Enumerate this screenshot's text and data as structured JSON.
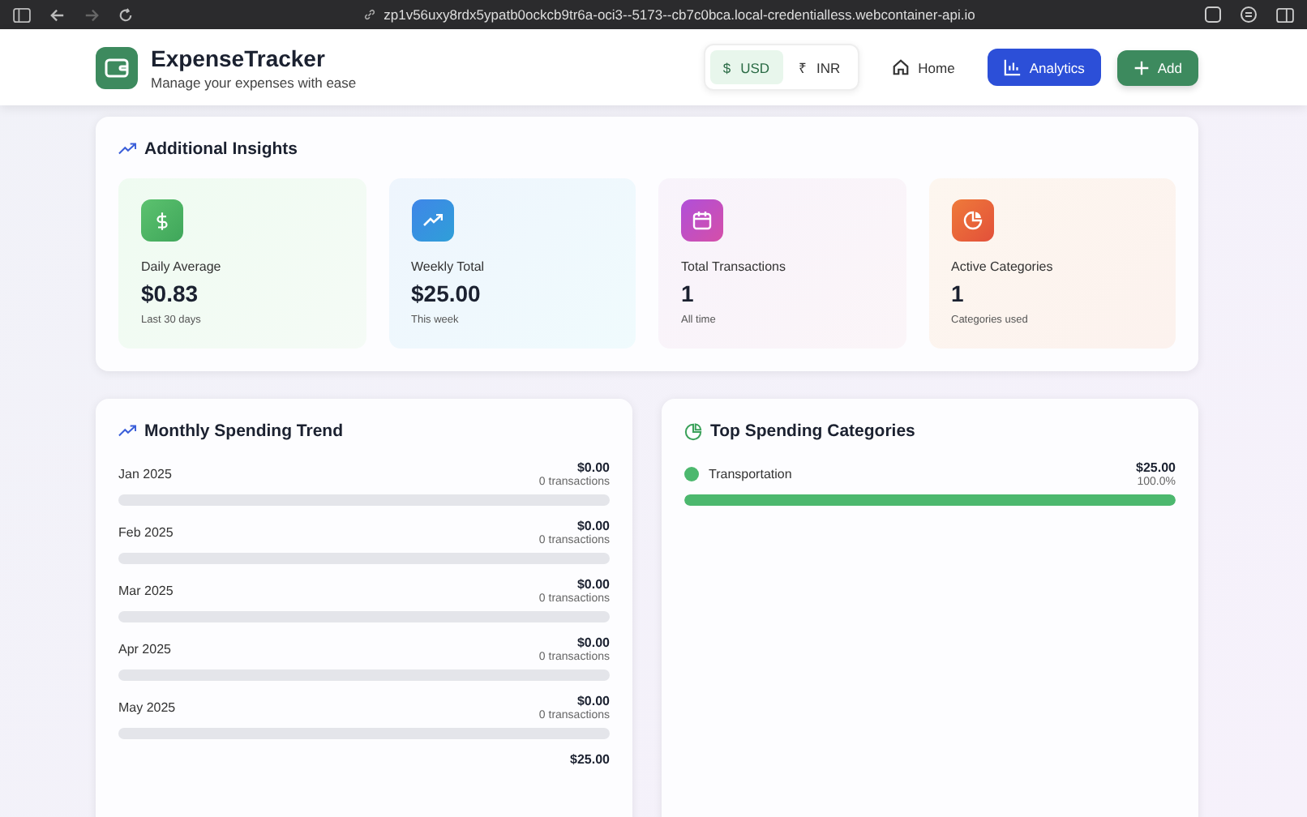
{
  "browser": {
    "url": "zp1v56uxy8rdx5ypatb0ockcb9tr6a-oci3--5173--cb7c0bca.local-credentialless.webcontainer-api.io"
  },
  "header": {
    "title": "ExpenseTracker",
    "subtitle": "Manage your expenses with ease",
    "currencies": [
      {
        "symbol": "$",
        "label": "USD",
        "selected": true
      },
      {
        "symbol": "₹",
        "label": "INR",
        "selected": false
      }
    ],
    "nav": [
      {
        "label": "Home",
        "kind": "home",
        "selected": false
      },
      {
        "label": "Analytics",
        "kind": "analytics",
        "selected": true
      },
      {
        "label": "Add",
        "kind": "add",
        "selected": false
      }
    ]
  },
  "insights": {
    "title": "Additional Insights",
    "cards": [
      {
        "kind": "dollar",
        "label": "Daily Average",
        "value": "$0.83",
        "note": "Last 30 days"
      },
      {
        "kind": "trend",
        "label": "Weekly Total",
        "value": "$25.00",
        "note": "This week"
      },
      {
        "kind": "calendar",
        "label": "Total Transactions",
        "value": "1",
        "note": "All time"
      },
      {
        "kind": "pie",
        "label": "Active Categories",
        "value": "1",
        "note": "Categories used"
      }
    ]
  },
  "monthly": {
    "title": "Monthly Spending Trend",
    "months": [
      {
        "label": "Jan 2025",
        "amount": "$0.00",
        "count": "0 transactions"
      },
      {
        "label": "Feb 2025",
        "amount": "$0.00",
        "count": "0 transactions"
      },
      {
        "label": "Mar 2025",
        "amount": "$0.00",
        "count": "0 transactions"
      },
      {
        "label": "Apr 2025",
        "amount": "$0.00",
        "count": "0 transactions"
      },
      {
        "label": "May 2025",
        "amount": "$0.00",
        "count": "0 transactions"
      },
      {
        "amount": "$25.00"
      }
    ]
  },
  "categories": {
    "title": "Top Spending Categories",
    "items": [
      {
        "name": "Transportation",
        "amount": "$25.00",
        "percent": "100.0%",
        "color": "#4cb86e",
        "level": 1
      }
    ]
  }
}
